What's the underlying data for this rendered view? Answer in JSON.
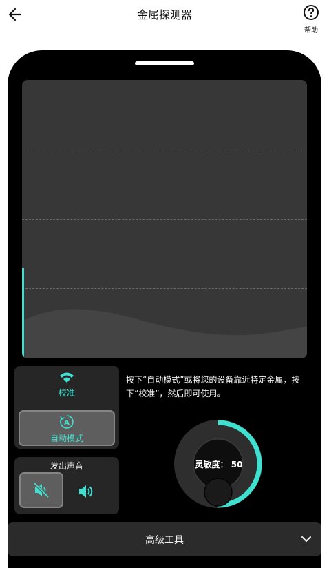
{
  "header": {
    "title": "金属探测器",
    "help_label": "帮助"
  },
  "detector": {
    "instruction": "按下“自动模式”或将您的设备靠近特定金属，按下“校准”，然后即可使用。",
    "calibrate_label": "校准",
    "auto_mode_label": "自动模式",
    "sound_title": "发出声音",
    "sensitivity_text": "灵敏度： 50",
    "sensitivity_value": 50
  },
  "footer": {
    "advanced_tools_label": "高级工具"
  },
  "colors": {
    "accent": "#40e0d0",
    "device": "#000000",
    "screen": "#373737",
    "panel": "#262626"
  }
}
